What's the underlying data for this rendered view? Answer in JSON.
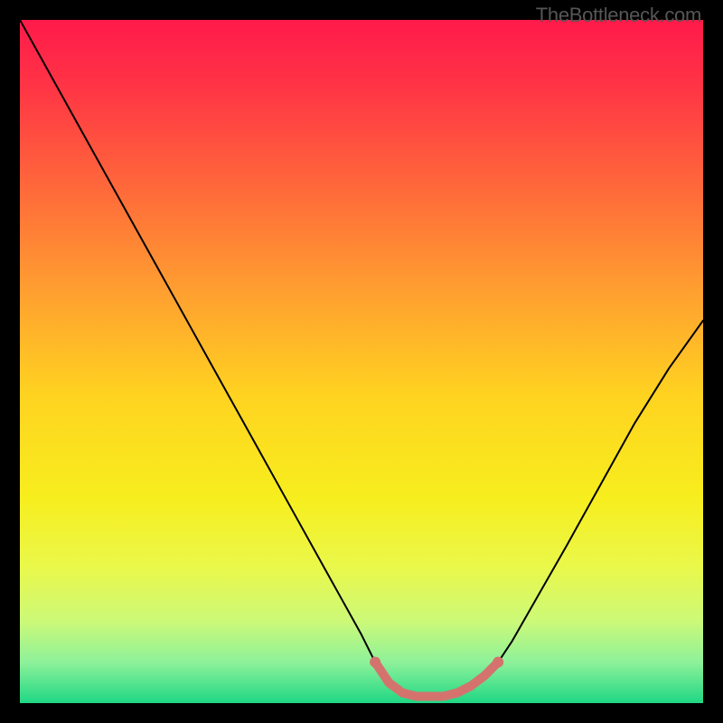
{
  "attribution": "TheBottleneck.com",
  "chart_data": {
    "type": "line",
    "title": "",
    "xlabel": "",
    "ylabel": "",
    "xlim": [
      0,
      100
    ],
    "ylim": [
      0,
      100
    ],
    "series": [
      {
        "name": "bottleneck-curve",
        "x": [
          0,
          5,
          10,
          15,
          20,
          25,
          30,
          35,
          40,
          45,
          50,
          52,
          54,
          56,
          58,
          60,
          62,
          64,
          66,
          68,
          70,
          72,
          76,
          80,
          85,
          90,
          95,
          100
        ],
        "values": [
          100,
          91,
          82,
          73,
          64,
          55,
          46,
          37,
          28,
          19,
          10,
          6,
          3,
          1.5,
          1,
          1,
          1,
          1.5,
          2.5,
          4,
          6,
          9,
          16,
          23,
          32,
          41,
          49,
          56
        ]
      }
    ],
    "highlight": {
      "name": "sweet-spot",
      "x": [
        52,
        54,
        56,
        58,
        60,
        62,
        64,
        66,
        68,
        70
      ],
      "values": [
        6,
        3,
        1.5,
        1,
        1,
        1,
        1.5,
        2.5,
        4,
        6
      ],
      "color": "#d4736e",
      "stroke_width": 10
    },
    "background_gradient": {
      "stops": [
        {
          "offset": 0.0,
          "color": "#ff1a4b"
        },
        {
          "offset": 0.1,
          "color": "#ff3545"
        },
        {
          "offset": 0.25,
          "color": "#ff6a3a"
        },
        {
          "offset": 0.4,
          "color": "#ffa030"
        },
        {
          "offset": 0.55,
          "color": "#ffd320"
        },
        {
          "offset": 0.7,
          "color": "#f7ee1e"
        },
        {
          "offset": 0.8,
          "color": "#eaf84a"
        },
        {
          "offset": 0.88,
          "color": "#ccf978"
        },
        {
          "offset": 0.94,
          "color": "#8ef19a"
        },
        {
          "offset": 1.0,
          "color": "#1fd784"
        }
      ]
    }
  }
}
